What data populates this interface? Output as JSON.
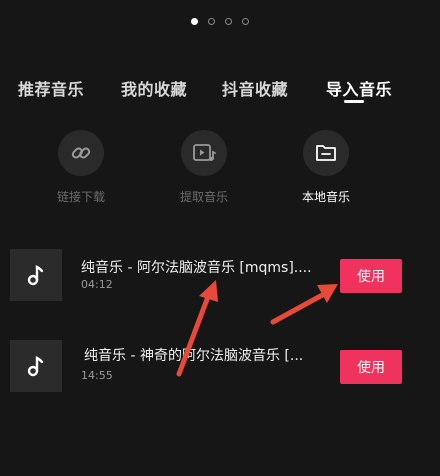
{
  "pager": {
    "count": 4,
    "active_index": 0
  },
  "tabs": [
    {
      "label": "推荐音乐"
    },
    {
      "label": "我的收藏"
    },
    {
      "label": "抖音收藏"
    },
    {
      "label": "导入音乐"
    }
  ],
  "active_tab": "导入音乐",
  "actions": [
    {
      "label": "链接下载",
      "icon": "link-icon"
    },
    {
      "label": "提取音乐",
      "icon": "video-music-icon"
    },
    {
      "label": "本地音乐",
      "icon": "folder-icon"
    }
  ],
  "songs": [
    {
      "title": "纯音乐 - 阿尔法脑波音乐 [mqms]....",
      "duration": "04:12",
      "button": "使用"
    },
    {
      "title": "纯音乐 - 神奇的阿尔法脑波音乐 [...",
      "duration": "14:55",
      "button": "使用"
    }
  ],
  "colors": {
    "background": "#161616",
    "accent": "#f0335e",
    "annotation_arrow": "#e84a3a"
  }
}
